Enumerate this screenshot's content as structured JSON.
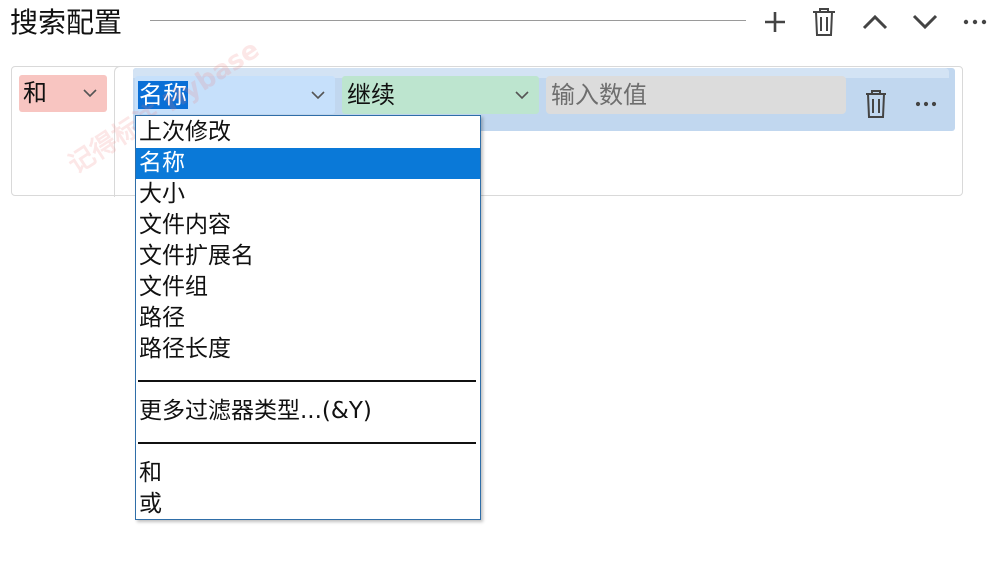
{
  "header": {
    "title": "搜索配置",
    "add_icon": "plus-icon",
    "delete_icon": "trash-icon",
    "up_icon": "chevron-up-icon",
    "down_icon": "chevron-down-icon",
    "more_icon": "ellipsis-icon"
  },
  "group": {
    "logic_value": "和"
  },
  "condition": {
    "field_value": "名称",
    "operator_value": "继续",
    "value_placeholder": "输入数值"
  },
  "dropdown": {
    "items": [
      "上次修改",
      "名称",
      "大小",
      "文件内容",
      "文件扩展名",
      "文件组",
      "路径",
      "路径长度",
      "更多过滤器类型...(&Y)",
      "和",
      "或"
    ],
    "selected_index": 1
  },
  "watermark": "记得标注 Hybase",
  "colors": {
    "logic_bg": "#f8c5c1",
    "field_bg": "#c6e0fb",
    "operator_bg": "#bde5cf",
    "row_bg": "#c1d7ef",
    "selection": "#0a79d8"
  }
}
